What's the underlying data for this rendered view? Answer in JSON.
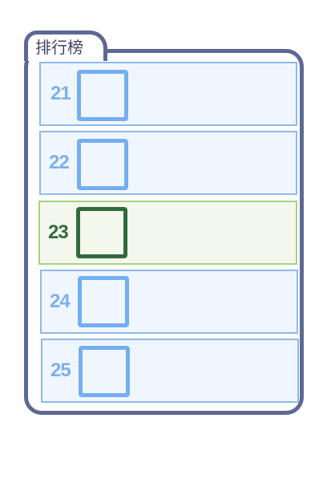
{
  "leaderboard": {
    "title": "排行榜",
    "rows": [
      {
        "rank": "21"
      },
      {
        "rank": "22"
      },
      {
        "rank": "23"
      },
      {
        "rank": "24"
      },
      {
        "rank": "25"
      }
    ],
    "highlighted_rank": "23"
  },
  "colors": {
    "frame": "#5d6993",
    "row_border": "#8ebaea",
    "row_fill": "#f0f6fe",
    "highlight_border": "#a6d27e",
    "highlight_fill": "#f4f8ec",
    "highlight_text": "#2f6b3d",
    "rank_text": "#7db0ea"
  }
}
